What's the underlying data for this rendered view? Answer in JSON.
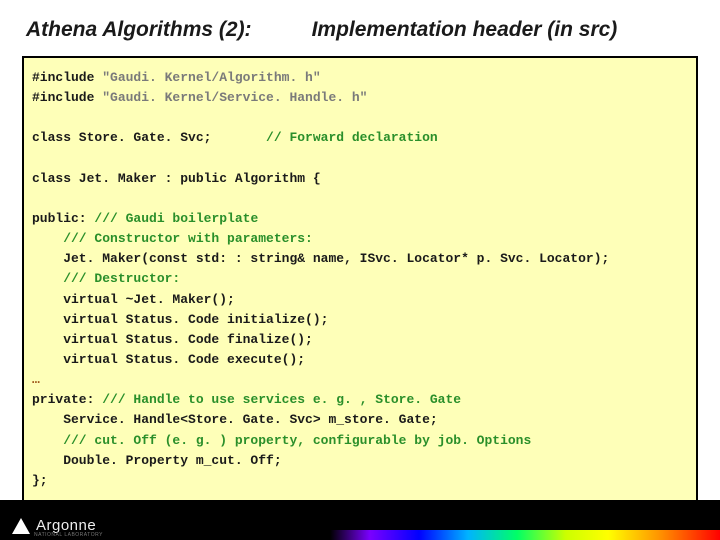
{
  "header": {
    "left": "Athena Algorithms (2):",
    "right": "Implementation header (in src)"
  },
  "code": {
    "l01a": "#include ",
    "l01b": "\"Gaudi. Kernel/Algorithm. h\"",
    "l02a": "#include ",
    "l02b": "\"Gaudi. Kernel/Service. Handle. h\"",
    "l03": "",
    "l04a": "class Store. Gate. Svc;       ",
    "l04b": "// Forward declaration",
    "l05": "",
    "l06": "class Jet. Maker : public Algorithm {",
    "l07": "",
    "l08a": "public: ",
    "l08b": "/// Gaudi boilerplate",
    "l09": "    /// Constructor with parameters:",
    "l10": "    Jet. Maker(const std: : string& name, ISvc. Locator* p. Svc. Locator);",
    "l11": "    /// Destructor:",
    "l12": "    virtual ~Jet. Maker();",
    "l13": "    virtual Status. Code initialize();",
    "l14": "    virtual Status. Code finalize();",
    "l15": "    virtual Status. Code execute();",
    "l16": "…",
    "l17a": "private: ",
    "l17b": "/// Handle to use services e. g. , Store. Gate",
    "l18": "    Service. Handle<Store. Gate. Svc> m_store. Gate;",
    "l19": "    /// cut. Off (e. g. ) property, configurable by job. Options",
    "l20": "    Double. Property m_cut. Off;",
    "l21": "};"
  },
  "footer": {
    "logo_text": "Argonne",
    "logo_subtext": "NATIONAL LABORATORY"
  }
}
